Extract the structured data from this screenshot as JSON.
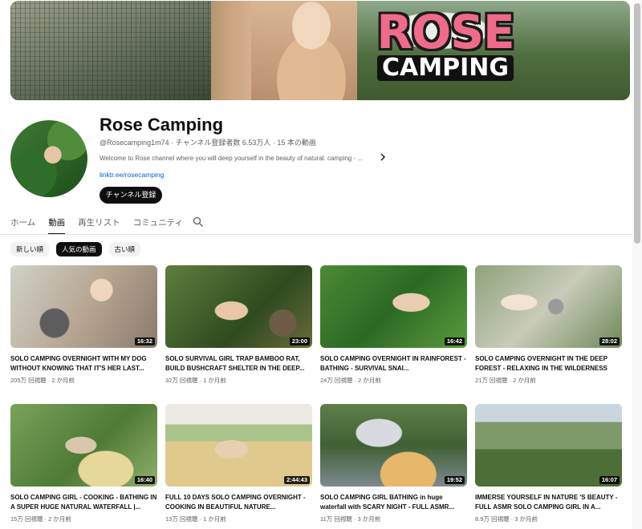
{
  "banner": {
    "logo_line1": "ROSE",
    "logo_line2": "CAMPING"
  },
  "channel": {
    "name": "Rose Camping",
    "meta": "@Rosecamping1m74 · チャンネル登録者数 6.53万人 · 15 本の動画",
    "description": "Welcome to Rose channel where you will deep yourself in the beauty of natural: camping - ...",
    "more_icon": "chevron-right-icon",
    "link": "linktr.ee/rosecamping",
    "subscribe_label": "チャンネル登録"
  },
  "tabs": [
    {
      "label": "ホーム",
      "active": false
    },
    {
      "label": "動画",
      "active": true
    },
    {
      "label": "再生リスト",
      "active": false
    },
    {
      "label": "コミュニティ",
      "active": false
    }
  ],
  "search_icon": "search-icon",
  "chips": [
    {
      "label": "新しい順",
      "active": false
    },
    {
      "label": "人気の動画",
      "active": true
    },
    {
      "label": "古い順",
      "active": false
    }
  ],
  "videos": [
    {
      "title": "SOLO CAMPING OVERNIGHT WITH MY DOG WITHOUT KNOWING THAT IT'S HER LAST...",
      "views": "205万 回視聴",
      "age": "2 か月前",
      "duration": "16:32"
    },
    {
      "title": "SOLO SURVIVAL GIRL TRAP BAMBOO RAT, BUILD BUSHCRAFT SHELTER IN THE DEEP...",
      "views": "32万 回視聴",
      "age": "1 か月前",
      "duration": "23:00"
    },
    {
      "title": "SOLO CAMPING OVERNIGHT IN RAINFOREST - BATHING - SURVIVAL SNAI...",
      "views": "24万 回視聴",
      "age": "2 か月前",
      "duration": "16:42"
    },
    {
      "title": "SOLO CAMPING OVERNIGHT IN THE DEEP FOREST - RELAXING IN THE WILDERNESS",
      "views": "21万 回視聴",
      "age": "2 か月前",
      "duration": "28:02"
    },
    {
      "title": "SOLO CAMPING GIRL - COOKING - BATHING IN A SUPER HUGE NATURAL WATERFALL |...",
      "views": "15万 回視聴",
      "age": "2 か月前",
      "duration": "16:40"
    },
    {
      "title": "FULL 10 DAYS SOLO CAMPING OVERNIGHT - COOKING IN BEAUTIFUL NATURE...",
      "views": "13万 回視聴",
      "age": "1 か月前",
      "duration": "2:44:43"
    },
    {
      "title": "SOLO CAMPING GIRL BATHING in huge waterfall with SCARY NIGHT - FULL ASMR...",
      "views": "11万 回視聴",
      "age": "3 か月前",
      "duration": "19:52"
    },
    {
      "title": "IMMERSE YOURSELF IN NATURE 'S BEAUTY - FULL ASMR SOLO CAMPING GIRL IN A...",
      "views": "8.9万 回視聴",
      "age": "3 か月前",
      "duration": "16:07"
    }
  ]
}
